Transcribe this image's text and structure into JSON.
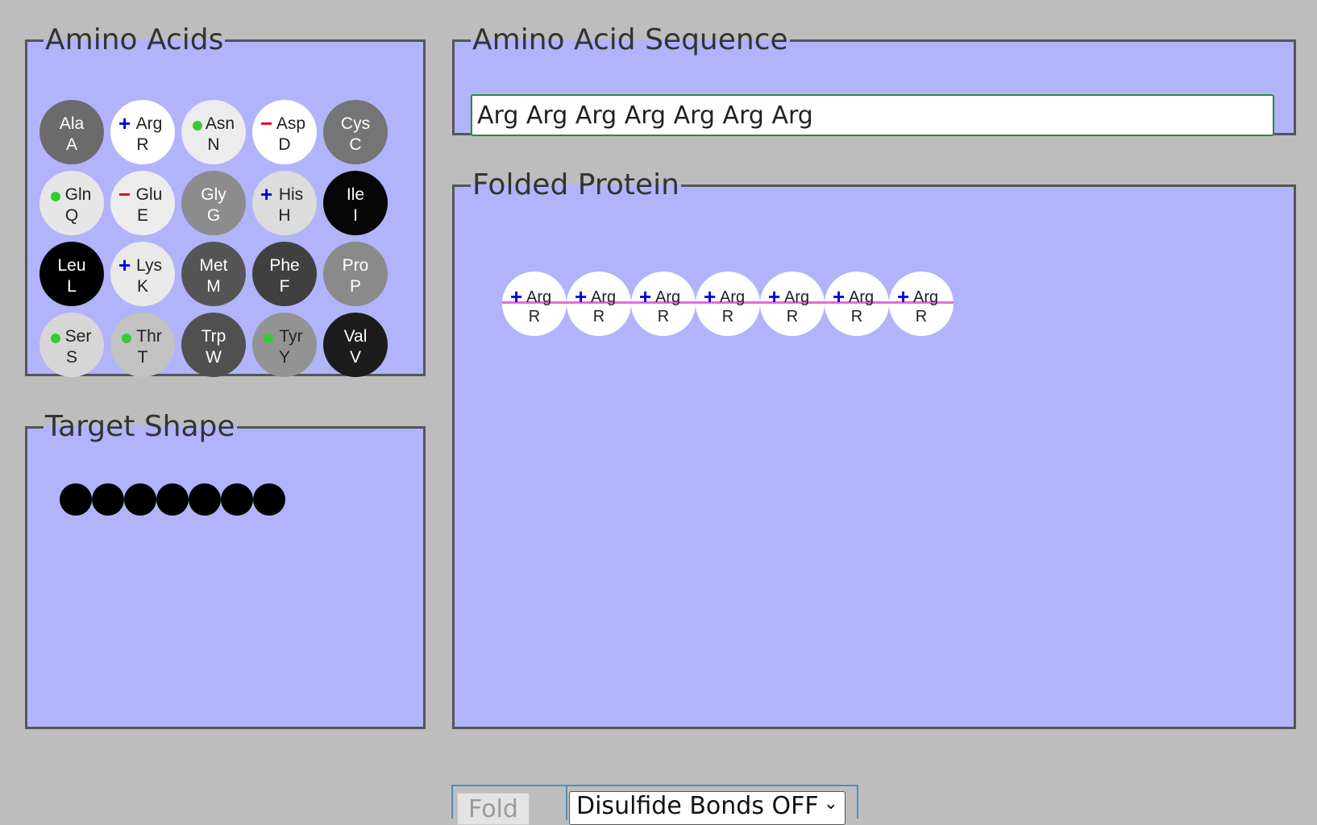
{
  "panels": {
    "amino_acids_title": "Amino Acids",
    "target_shape_title": "Target Shape",
    "sequence_title": "Amino Acid Sequence",
    "folded_title": "Folded Protein"
  },
  "amino_acids": [
    {
      "abbr": "Ala",
      "code": "A",
      "bg": "#6b6b6b",
      "fg": "#ffffff",
      "mark": ""
    },
    {
      "abbr": "Arg",
      "code": "R",
      "bg": "#ffffff",
      "fg": "#222222",
      "mark": "+",
      "mark_color": "#0000dd"
    },
    {
      "abbr": "Asn",
      "code": "N",
      "bg": "#ececec",
      "fg": "#222222",
      "mark": "dot"
    },
    {
      "abbr": "Asp",
      "code": "D",
      "bg": "#ffffff",
      "fg": "#222222",
      "mark": "−",
      "mark_color": "#dd0000"
    },
    {
      "abbr": "Cys",
      "code": "C",
      "bg": "#757575",
      "fg": "#ffffff",
      "mark": ""
    },
    {
      "abbr": "Gln",
      "code": "Q",
      "bg": "#e6e6e6",
      "fg": "#222222",
      "mark": "dot"
    },
    {
      "abbr": "Glu",
      "code": "E",
      "bg": "#ececec",
      "fg": "#222222",
      "mark": "−",
      "mark_color": "#dd0000"
    },
    {
      "abbr": "Gly",
      "code": "G",
      "bg": "#8c8c8c",
      "fg": "#ffffff",
      "mark": ""
    },
    {
      "abbr": "His",
      "code": "H",
      "bg": "#dcdcdc",
      "fg": "#222222",
      "mark": "+",
      "mark_color": "#0000dd"
    },
    {
      "abbr": "Ile",
      "code": "I",
      "bg": "#050505",
      "fg": "#ffffff",
      "mark": ""
    },
    {
      "abbr": "Leu",
      "code": "L",
      "bg": "#000000",
      "fg": "#ffffff",
      "mark": ""
    },
    {
      "abbr": "Lys",
      "code": "K",
      "bg": "#e9e9e9",
      "fg": "#222222",
      "mark": "+",
      "mark_color": "#0000dd"
    },
    {
      "abbr": "Met",
      "code": "M",
      "bg": "#555555",
      "fg": "#ffffff",
      "mark": ""
    },
    {
      "abbr": "Phe",
      "code": "F",
      "bg": "#404040",
      "fg": "#ffffff",
      "mark": ""
    },
    {
      "abbr": "Pro",
      "code": "P",
      "bg": "#8a8a8a",
      "fg": "#ffffff",
      "mark": ""
    },
    {
      "abbr": "Ser",
      "code": "S",
      "bg": "#d6d6d6",
      "fg": "#222222",
      "mark": "dot"
    },
    {
      "abbr": "Thr",
      "code": "T",
      "bg": "#c2c2c2",
      "fg": "#222222",
      "mark": "dot"
    },
    {
      "abbr": "Trp",
      "code": "W",
      "bg": "#505050",
      "fg": "#ffffff",
      "mark": ""
    },
    {
      "abbr": "Tyr",
      "code": "Y",
      "bg": "#939393",
      "fg": "#222222",
      "mark": "dot"
    },
    {
      "abbr": "Val",
      "code": "V",
      "bg": "#1c1c1c",
      "fg": "#ffffff",
      "mark": ""
    }
  ],
  "sequence": {
    "value": "Arg Arg Arg Arg Arg Arg Arg"
  },
  "target_shape": {
    "bead_count": 7
  },
  "folded_protein": {
    "beads": [
      {
        "abbr": "Arg",
        "code": "R",
        "mark": "+"
      },
      {
        "abbr": "Arg",
        "code": "R",
        "mark": "+"
      },
      {
        "abbr": "Arg",
        "code": "R",
        "mark": "+"
      },
      {
        "abbr": "Arg",
        "code": "R",
        "mark": "+"
      },
      {
        "abbr": "Arg",
        "code": "R",
        "mark": "+"
      },
      {
        "abbr": "Arg",
        "code": "R",
        "mark": "+"
      },
      {
        "abbr": "Arg",
        "code": "R",
        "mark": "+"
      }
    ]
  },
  "controls": {
    "fold_label": "Fold",
    "disulfide_selected": "Disulfide Bonds OFF"
  },
  "colors": {
    "panel_bg": "#b1b3fb",
    "page_bg": "#bdbdbd",
    "chain_line": "#e06ce0",
    "positive": "#0000dd",
    "negative": "#dd0000",
    "polar": "#33cc33"
  }
}
